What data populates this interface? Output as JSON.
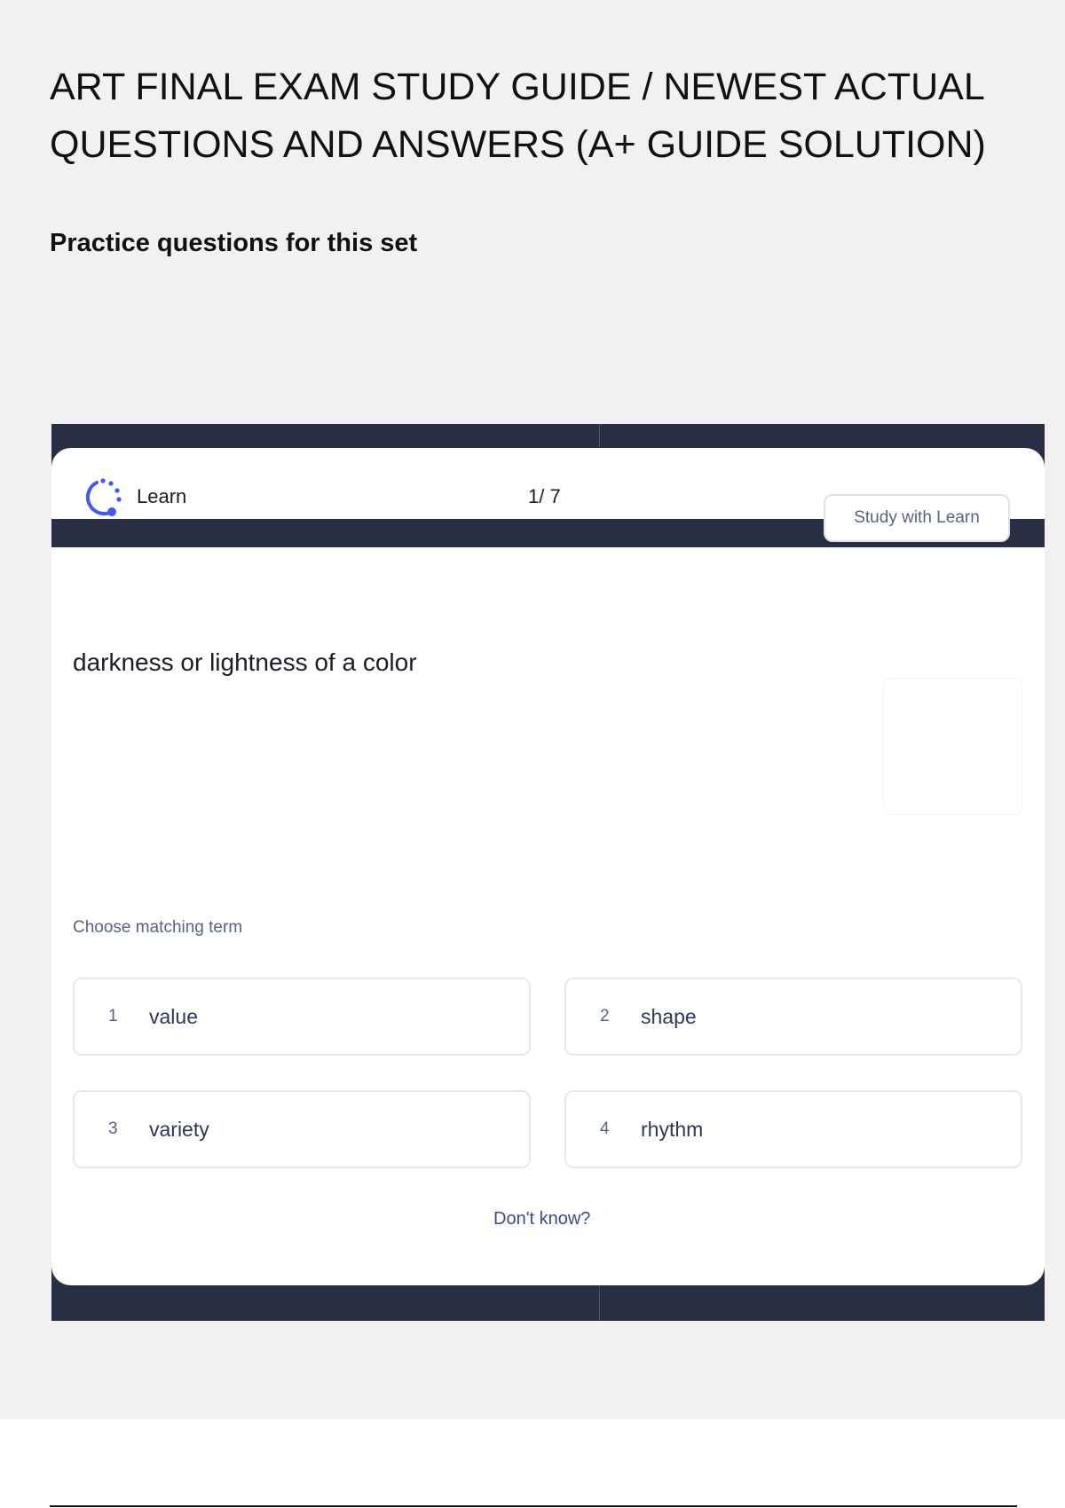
{
  "document": {
    "title": "ART FINAL EXAM STUDY GUIDE / NEWEST ACTUAL QUESTIONS AND ANSWERS (A+ GUIDE SOLUTION)",
    "subtitle": "Practice questions for this set"
  },
  "widget": {
    "header": {
      "logo_icon": "learn-icon",
      "label": "Learn",
      "counter": "1/ 7",
      "study_button": "Study with Learn"
    },
    "question": {
      "term": "darkness or lightness of a color",
      "prompt": "Choose matching term"
    },
    "options": [
      {
        "number": "1",
        "label": "value"
      },
      {
        "number": "2",
        "label": "shape"
      },
      {
        "number": "3",
        "label": "variety"
      },
      {
        "number": "4",
        "label": "rhythm"
      }
    ],
    "dont_know": "Don't know?"
  },
  "colors": {
    "page_background": "#f1f1f1",
    "frame": "#2a2e42",
    "accent": "#4255ff",
    "link": "#3b4a8a"
  }
}
